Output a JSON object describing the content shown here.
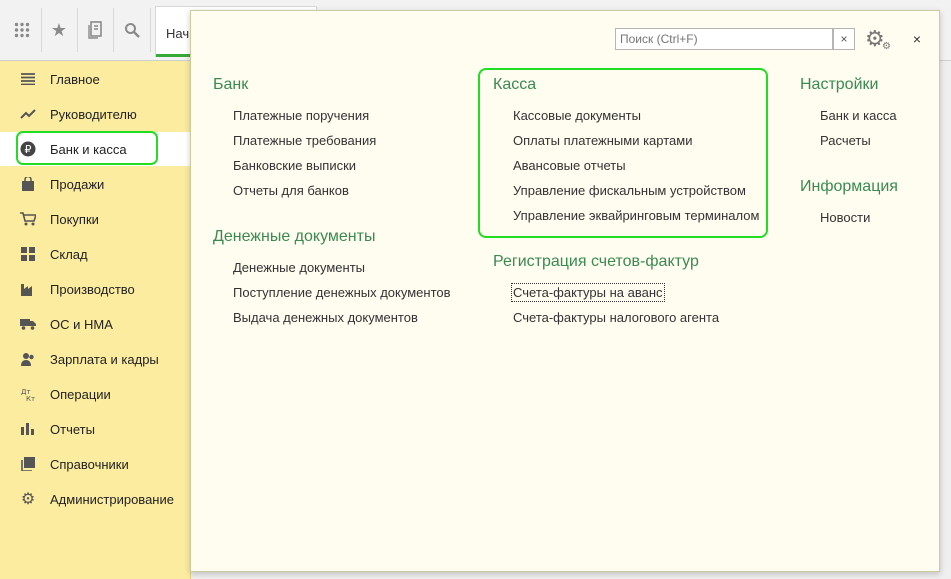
{
  "toolbar": {
    "icons": [
      "apps-grid-icon",
      "star-icon",
      "history-icon",
      "search-icon"
    ],
    "start_tab_label": "Нач"
  },
  "sidebar": {
    "items": [
      {
        "label": "Главное",
        "icon": "menu-lines-icon",
        "glyph": "≡"
      },
      {
        "label": "Руководителю",
        "icon": "trend-icon",
        "glyph": "↗"
      },
      {
        "label": "Банк и касса",
        "icon": "ruble-icon",
        "glyph": "₽"
      },
      {
        "label": "Продажи",
        "icon": "bag-icon",
        "glyph": "▣"
      },
      {
        "label": "Покупки",
        "icon": "cart-icon",
        "glyph": "⛟"
      },
      {
        "label": "Склад",
        "icon": "warehouse-icon",
        "glyph": "▦"
      },
      {
        "label": "Производство",
        "icon": "factory-icon",
        "glyph": "▙"
      },
      {
        "label": "ОС и НМА",
        "icon": "truck-icon",
        "glyph": "⛟"
      },
      {
        "label": "Зарплата и кадры",
        "icon": "people-icon",
        "glyph": "☻"
      },
      {
        "label": "Операции",
        "icon": "dt-kt-icon",
        "glyph": "⇅"
      },
      {
        "label": "Отчеты",
        "icon": "bar-chart-icon",
        "glyph": "▮"
      },
      {
        "label": "Справочники",
        "icon": "book-icon",
        "glyph": "❐"
      },
      {
        "label": "Администрирование",
        "icon": "gear-icon",
        "glyph": "⚙"
      }
    ],
    "active_index": 2
  },
  "panel": {
    "search_placeholder": "Поиск (Ctrl+F)",
    "clear_label": "×",
    "close_label": "×",
    "sections": {
      "bank": {
        "title": "Банк",
        "links": [
          "Платежные поручения",
          "Платежные требования",
          "Банковские выписки",
          "Отчеты для банков"
        ]
      },
      "money_docs": {
        "title": "Денежные документы",
        "links": [
          "Денежные документы",
          "Поступление денежных документов",
          "Выдача денежных документов"
        ]
      },
      "kassa": {
        "title": "Касса",
        "links": [
          "Кассовые документы",
          "Оплаты платежными картами",
          "Авансовые отчеты",
          "Управление фискальным устройством",
          "Управление эквайринговым терминалом"
        ]
      },
      "invoices": {
        "title": "Регистрация счетов-фактур",
        "links": [
          "Счета-фактуры на аванс",
          "Счета-фактуры налогового агента"
        ]
      },
      "settings": {
        "title": "Настройки",
        "links": [
          "Банк и касса",
          "Расчеты"
        ]
      },
      "info": {
        "title": "Информация",
        "links": [
          "Новости"
        ]
      }
    }
  },
  "colors": {
    "sidebar_bg": "#fbeca0",
    "section_title": "#3a8a52",
    "highlight": "#22dd22"
  }
}
